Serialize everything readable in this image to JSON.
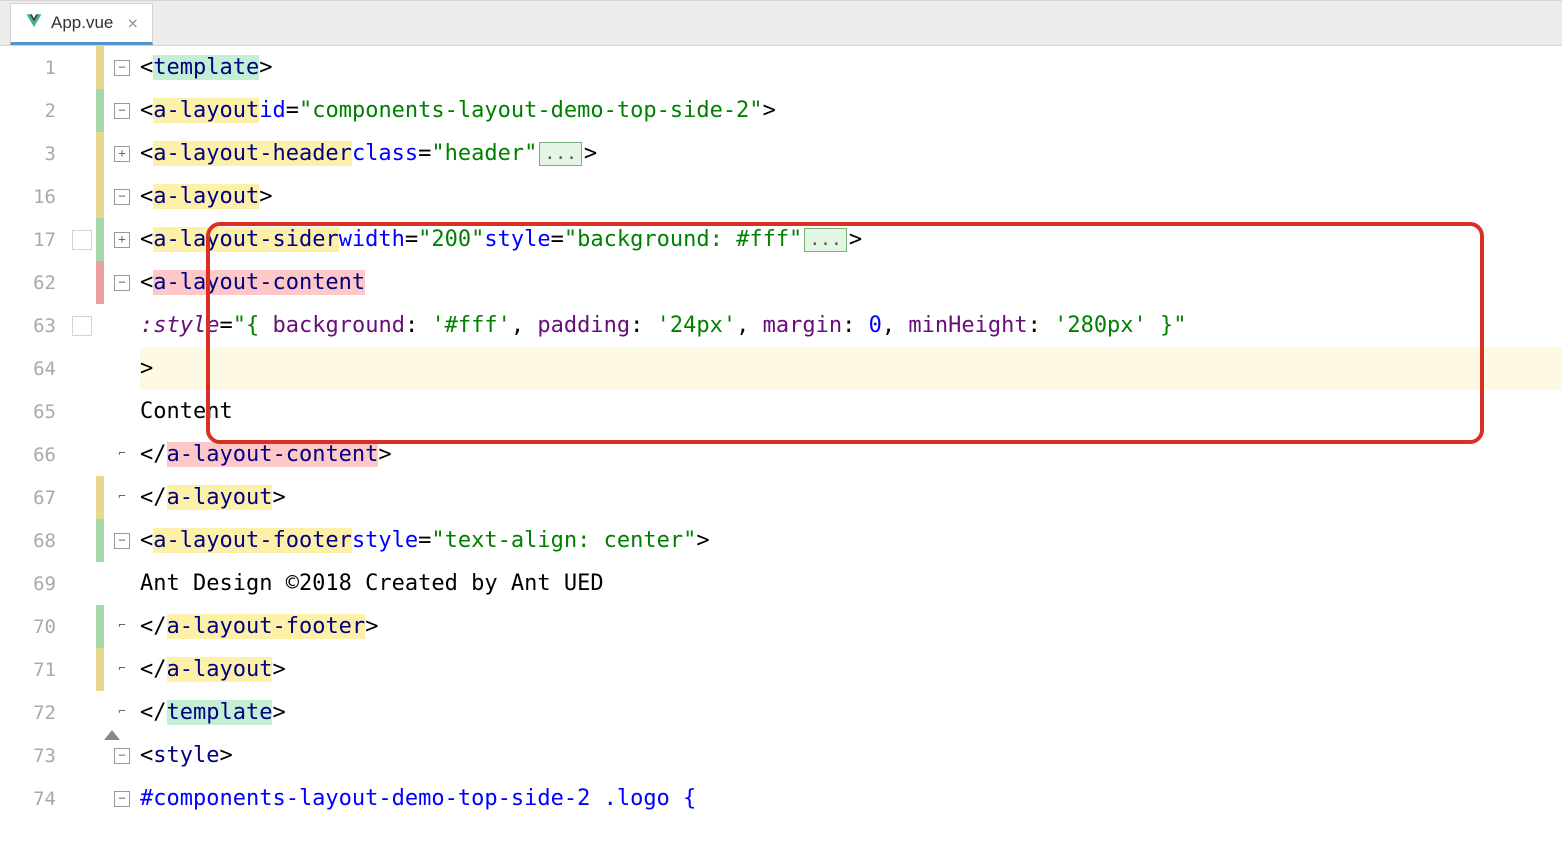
{
  "tab": {
    "filename": "App.vue",
    "close_label": "×"
  },
  "lines": {
    "l1": {
      "num": "1"
    },
    "l2": {
      "num": "2"
    },
    "l3": {
      "num": "3"
    },
    "l16": {
      "num": "16"
    },
    "l17": {
      "num": "17"
    },
    "l62": {
      "num": "62"
    },
    "l63": {
      "num": "63"
    },
    "l64": {
      "num": "64"
    },
    "l65": {
      "num": "65"
    },
    "l66": {
      "num": "66"
    },
    "l67": {
      "num": "67"
    },
    "l68": {
      "num": "68"
    },
    "l69": {
      "num": "69"
    },
    "l70": {
      "num": "70"
    },
    "l71": {
      "num": "71"
    },
    "l72": {
      "num": "72"
    },
    "l73": {
      "num": "73"
    },
    "l74": {
      "num": "74"
    }
  },
  "code": {
    "template_open": "template",
    "template_close": "template",
    "a_layout": "a-layout",
    "a_layout_header": "a-layout-header",
    "a_layout_sider": "a-layout-sider",
    "a_layout_content": "a-layout-content",
    "a_layout_footer": "a-layout-footer",
    "id_attr": "id",
    "id_val": "\"components-layout-demo-top-side-2\"",
    "class_attr": "class",
    "class_val": "\"header\"",
    "width_attr": "width",
    "width_val": "\"200\"",
    "style_attr": "style",
    "style_val_sider": "\"background: #fff\"",
    "style_val_footer": "\"text-align: center\"",
    "bind_style": ":style",
    "style_obj_open": "\"{ ",
    "style_obj_close": " }\"",
    "bg_key": "background",
    "bg_val": "'#fff'",
    "padding_key": "padding",
    "padding_val": "'24px'",
    "margin_key": "margin",
    "margin_val": "0",
    "minheight_key": "minHeight",
    "minheight_val": "'280px'",
    "content_text": "Content",
    "footer_text": "Ant Design ©2018 Created by Ant UED",
    "style_tag": "style",
    "css_line": "#components-layout-demo-top-side-2 .logo {",
    "dots": "...",
    "comma": ", ",
    "colon": ": ",
    "eq": "=",
    "lt": "<",
    "gt": ">",
    "lt_slash": "</"
  }
}
